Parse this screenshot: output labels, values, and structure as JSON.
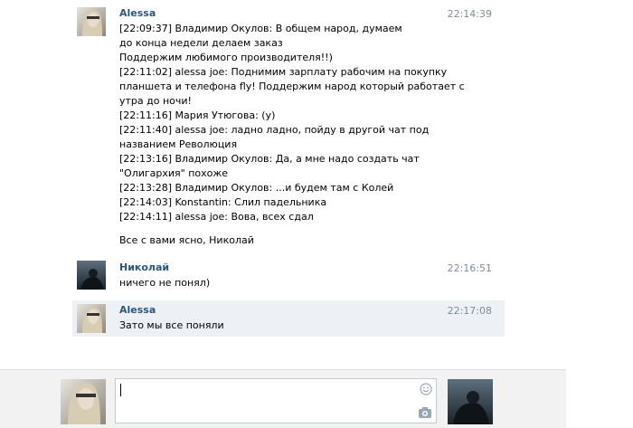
{
  "messages": [
    {
      "author": "Alessa",
      "time": "22:14:39",
      "lines": [
        "[22:09:37] Владимир Окулов: В общем народ, думаем",
        "до конца недели делаем заказ",
        "Поддержим любимого производителя!!)",
        "[22:11:02] alessa joe: Поднимим зарплату рабочим на покупку",
        "планшета и телефона fly! Поддержим народ который работает с",
        "утра до ночи!",
        "[22:11:16] Мария Утюгова: (у)",
        "[22:11:40] alessa joe: ладно ладно, пойду в другой чат под",
        "названием Революция",
        "[22:13:16] Владимир Окулов: Да, а мне надо создать чат",
        "\"Олигархия\" похоже",
        "[22:13:28] Владимир Окулов: ...и будем там с Колей",
        "[22:14:03] Konstantin: Слил падельника",
        "[22:14:11] alessa joe: Вова, всех сдал"
      ],
      "extra": "Все с вами ясно, Николай"
    },
    {
      "author": "Николай",
      "time": "22:16:51",
      "text": "ничего не понял)"
    },
    {
      "author": "Alessa",
      "time": "22:17:08",
      "text": "Зато мы все поняли"
    }
  ],
  "composer": {
    "value": "",
    "icons": [
      "smile-icon",
      "camera-icon"
    ]
  },
  "colors": {
    "author": "#2b587a",
    "time": "#7f8c98",
    "highlight": "#edf1f5"
  }
}
